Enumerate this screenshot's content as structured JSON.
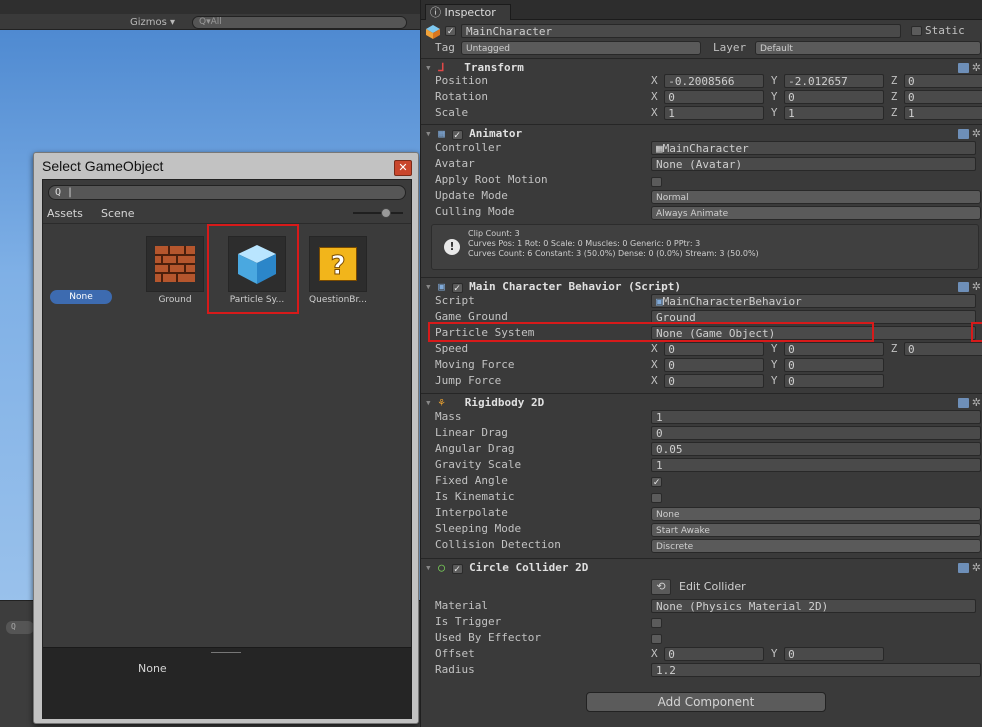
{
  "scene": {
    "gizmos_label": "Gizmos ▾",
    "search_placeholder": "Q▾All",
    "lower_search": "Q"
  },
  "dialog": {
    "title": "Select GameObject",
    "close_glyph": "✕",
    "search_value": "Q |",
    "tabs": [
      "Assets",
      "Scene"
    ],
    "items": [
      {
        "label": "None"
      },
      {
        "label": "Ground"
      },
      {
        "label": "Particle Sy..."
      },
      {
        "label": "QuestionBr..."
      }
    ],
    "preview_label": "None"
  },
  "inspector": {
    "tab_title": "Inspector",
    "object_name": "MainCharacter",
    "static_label": "Static",
    "tag_label": "Tag",
    "tag_value": "Untagged",
    "layer_label": "Layer",
    "layer_value": "Default",
    "transform": {
      "title": "Transform",
      "position_label": "Position",
      "position": [
        "-0.2008566",
        "-2.012657",
        "0"
      ],
      "rotation_label": "Rotation",
      "rotation": [
        "0",
        "0",
        "0"
      ],
      "scale_label": "Scale",
      "scale": [
        "1",
        "1",
        "1"
      ]
    },
    "animator": {
      "title": "Animator",
      "controller_label": "Controller",
      "controller": "MainCharacter",
      "avatar_label": "Avatar",
      "avatar": "None (Avatar)",
      "apply_root_motion_label": "Apply Root Motion",
      "update_mode_label": "Update Mode",
      "update_mode": "Normal",
      "culling_mode_label": "Culling Mode",
      "culling_mode": "Always Animate",
      "info1": "Clip Count: 3",
      "info2": "Curves Pos: 1 Rot: 0 Scale: 0 Muscles: 0 Generic: 0 PPtr: 3",
      "info3": "Curves Count: 6 Constant: 3 (50.0%) Dense: 0 (0.0%) Stream: 3 (50.0%)"
    },
    "behavior": {
      "title": "Main Character Behavior (Script)",
      "script_label": "Script",
      "script": "MainCharacterBehavior",
      "game_ground_label": "Game Ground",
      "game_ground": "Ground",
      "particle_label": "Particle System",
      "particle": "None (Game Object)",
      "speed_label": "Speed",
      "speed": [
        "0",
        "0",
        "0"
      ],
      "moving_force_label": "Moving Force",
      "moving_force": [
        "0",
        "0"
      ],
      "jump_force_label": "Jump Force",
      "jump_force": [
        "0",
        "0"
      ]
    },
    "rigidbody": {
      "title": "Rigidbody 2D",
      "mass_label": "Mass",
      "mass": "1",
      "linear_drag_label": "Linear Drag",
      "linear_drag": "0",
      "angular_drag_label": "Angular Drag",
      "angular_drag": "0.05",
      "gravity_label": "Gravity Scale",
      "gravity": "1",
      "fixed_angle_label": "Fixed Angle",
      "kinematic_label": "Is Kinematic",
      "interpolate_label": "Interpolate",
      "interpolate": "None",
      "sleeping_label": "Sleeping Mode",
      "sleeping": "Start Awake",
      "collision_label": "Collision Detection",
      "collision": "Discrete"
    },
    "collider": {
      "title": "Circle Collider 2D",
      "edit_label": "Edit Collider",
      "material_label": "Material",
      "material": "None (Physics Material 2D)",
      "trigger_label": "Is Trigger",
      "effector_label": "Used By Effector",
      "offset_label": "Offset",
      "offset": [
        "0",
        "0"
      ],
      "radius_label": "Radius",
      "radius": "1.2"
    },
    "add_component": "Add Component",
    "axis": [
      "X",
      "Y",
      "Z"
    ]
  },
  "colors": {
    "highlight": "#d71a1a",
    "selected": "#3d6bb0"
  }
}
